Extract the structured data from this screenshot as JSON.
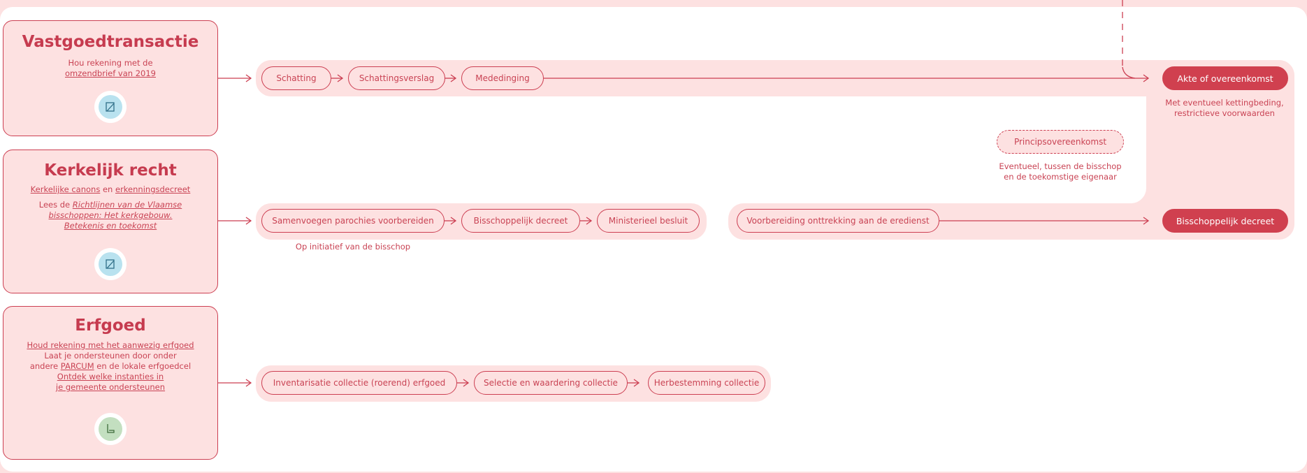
{
  "cards": [
    {
      "title": "Vastgoedtransactie",
      "line1": "Hou rekening met de",
      "link1": "omzendbrief van 2019",
      "icon": "document-pen-icon"
    },
    {
      "title": "Kerkelijk recht",
      "link_a": "Kerkelijke canons",
      "mid": " en ",
      "link_b": "erkenningsdecreet",
      "lees_prefix": "Lees de ",
      "lees_link1": "Richtlijnen van de Vlaamse",
      "lees_link2": "bisschoppen: Het kerkgebouw.",
      "lees_link3": "Betekenis en toekomst",
      "icon": "document-pen-icon"
    },
    {
      "title": "Erfgoed",
      "link1": "Houd rekening met het aanwezig erfgoed",
      "line2": "Laat je ondersteunen door onder",
      "line3_prefix": "andere ",
      "line3_link": "PARCUM",
      "line3_suffix": " en de lokale erfgoedcel",
      "link2a": "Ontdek welke instanties in",
      "link2b": "je gemeente ondersteunen",
      "icon": "chair-icon"
    }
  ],
  "row1": {
    "steps": [
      "Schatting",
      "Schattingsverslag",
      "Mededinging"
    ],
    "final": "Akte of overeenkomst",
    "final_note_1": "Met eventueel kettingbeding,",
    "final_note_2": "restrictieve voorwaarden"
  },
  "principle": {
    "label": "Principsovereenkomst",
    "note_1": "Eventueel, tussen de bisschop",
    "note_2": "en de toekomstige eigenaar"
  },
  "row2": {
    "steps": [
      "Samenvoegen parochies voorbereiden",
      "Bisschoppelijk decreet",
      "Ministerieel besluit"
    ],
    "note": "Op initiatief van de bisschop",
    "steps_b": [
      "Voorbereiding onttrekking aan de eredienst"
    ],
    "final": "Bisschoppelijk decreet"
  },
  "row3": {
    "steps": [
      "Inventarisatie collectie (roerend) erfgoed",
      "Selectie en waardering collectie",
      "Herbestemming collectie"
    ]
  },
  "colors": {
    "accent": "#d0404f",
    "light": "#fde1e1",
    "icon_blue": "#b9e2ef",
    "icon_green": "#c3dfc0"
  }
}
